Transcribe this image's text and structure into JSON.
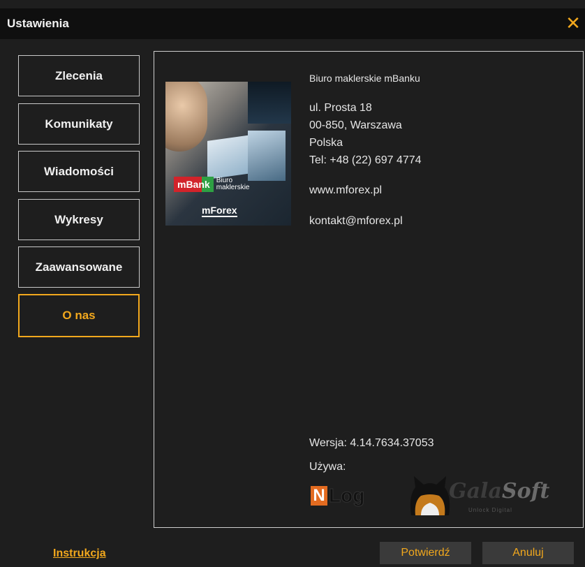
{
  "window": {
    "title": "Ustawienia",
    "close_icon": "close-icon"
  },
  "nav": {
    "items": [
      {
        "label": "Zlecenia"
      },
      {
        "label": "Komunikaty"
      },
      {
        "label": "Wiadomości"
      },
      {
        "label": "Wykresy"
      },
      {
        "label": "Zaawansowane"
      },
      {
        "label": "O nas",
        "active": true
      }
    ]
  },
  "about": {
    "image_text": {
      "brand": "mBank",
      "biuro_line1": "Biuro",
      "biuro_line2": "maklerskie",
      "product": "mForex"
    },
    "company": "Biuro maklerskie mBanku",
    "street": "ul. Prosta 18",
    "postal": "00-850, Warszawa",
    "country": "Polska",
    "phone": "Tel: +48 (22) 697 4774",
    "website": "www.mforex.pl",
    "email": "kontakt@mforex.pl",
    "version": "Wersja: 4.14.7634.37053",
    "uses": "Używa:",
    "logos": {
      "nlog_letter": "N",
      "nlog_text": "Log",
      "gala": "Gala",
      "soft": "Soft",
      "gala_sub": "Unlock Digital"
    }
  },
  "footer": {
    "instructions": "Instrukcja",
    "confirm": "Potwierdź",
    "cancel": "Anuluj"
  },
  "colors": {
    "accent": "#f2a81d",
    "background": "#1e1e1e",
    "titlebar": "#0f0f0f"
  }
}
